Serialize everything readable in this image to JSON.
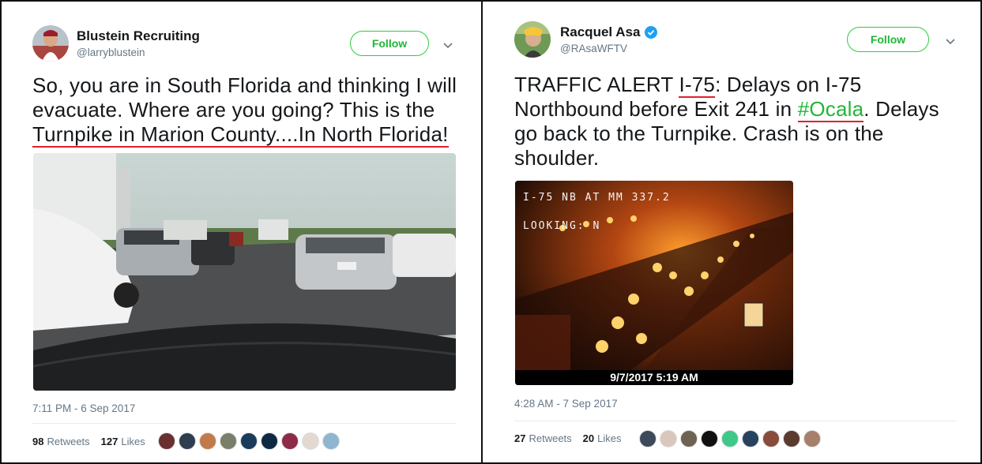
{
  "colors": {
    "follow_green": "#21b637",
    "underline_red": "#e0212d",
    "link_blue": "#1da1f2"
  },
  "tweets": [
    {
      "user": {
        "display_name": "Blustein Recruiting",
        "handle": "@larryblustein",
        "avatar_icon": "profile-photo"
      },
      "follow_label": "Follow",
      "text": {
        "line1": "So, you are in South Florida and thinking I will",
        "line2": "evacuate. Where are you going? This is the",
        "line3": "Turnpike in Marion County....In North Florida!"
      },
      "timestamp": "7:11 PM - 6 Sep 2017",
      "retweets_count": "98",
      "retweets_label": "Retweets",
      "likes_count": "127",
      "likes_label": "Likes"
    },
    {
      "user": {
        "display_name": "Racquel Asa",
        "handle": "@RAsaWFTV",
        "verified": true,
        "avatar_icon": "profile-photo"
      },
      "follow_label": "Follow",
      "text": {
        "l1a": "TRAFFIC ALERT ",
        "l1b": "I-75",
        "l1c": ": Delays on I-75",
        "l2a": "Northbound before Exit 241 in ",
        "l2b": "#Ocala",
        "l2c": ". Delays",
        "line3": "go back to the Turnpike. Crash is on the",
        "line4": "shoulder."
      },
      "camera_overlay": {
        "line1": "I-75 NB AT MM 337.2",
        "line2": "LOOKING:  N",
        "datetime": "9/7/2017 5:19 AM"
      },
      "timestamp": "4:28 AM - 7 Sep 2017",
      "retweets_count": "27",
      "retweets_label": "Retweets",
      "likes_count": "20",
      "likes_label": "Likes"
    }
  ]
}
